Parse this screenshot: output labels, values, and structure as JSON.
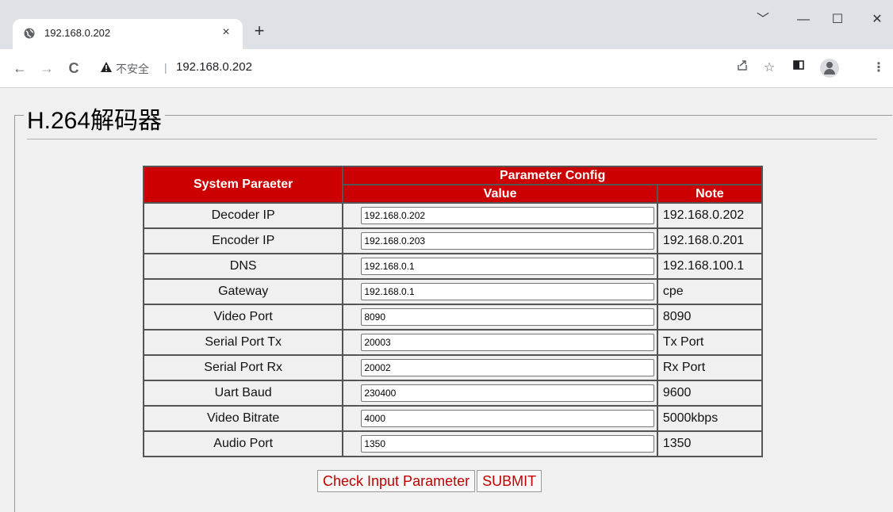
{
  "browser": {
    "tab_title": "192.168.0.202",
    "tab_close": "×",
    "new_tab": "+",
    "window_controls": [
      "﹀",
      "—",
      "☐",
      "✕"
    ],
    "nav": {
      "back": "←",
      "forward": "→",
      "reload": "C"
    },
    "insecure_label": "不安全",
    "separator": "|",
    "url": "192.168.0.202",
    "toolbar_icons": [
      "share-icon",
      "star-icon",
      "sidebar-icon",
      "profile-avatar",
      "menu-icon"
    ]
  },
  "page": {
    "legend": "H.264解码器",
    "table": {
      "col_system": "System Paraeter",
      "col_group": "Parameter Config",
      "col_value": "Value",
      "col_note": "Note",
      "rows": [
        {
          "name": "Decoder IP",
          "value": "192.168.0.202",
          "note": "192.168.0.202"
        },
        {
          "name": "Encoder IP",
          "value": "192.168.0.203",
          "note": "192.168.0.201"
        },
        {
          "name": "DNS",
          "value": "192.168.0.1",
          "note": "192.168.100.1"
        },
        {
          "name": "Gateway",
          "value": "192.168.0.1",
          "note": "cpe"
        },
        {
          "name": "Video Port",
          "value": "8090",
          "note": "8090"
        },
        {
          "name": "Serial Port Tx",
          "value": "20003",
          "note": " Tx Port"
        },
        {
          "name": "Serial Port Rx",
          "value": "20002",
          "note": " Rx Port"
        },
        {
          "name": "Uart Baud",
          "value": "230400",
          "note": "9600"
        },
        {
          "name": "Video Bitrate",
          "value": "4000",
          "note": "5000kbps"
        },
        {
          "name": "Audio Port",
          "value": "1350",
          "note": "1350"
        }
      ]
    },
    "buttons": {
      "check": "Check Input Parameter",
      "submit": "SUBMIT"
    },
    "colors": {
      "header_bg": "#cc0000",
      "button_text": "#c00000"
    }
  }
}
